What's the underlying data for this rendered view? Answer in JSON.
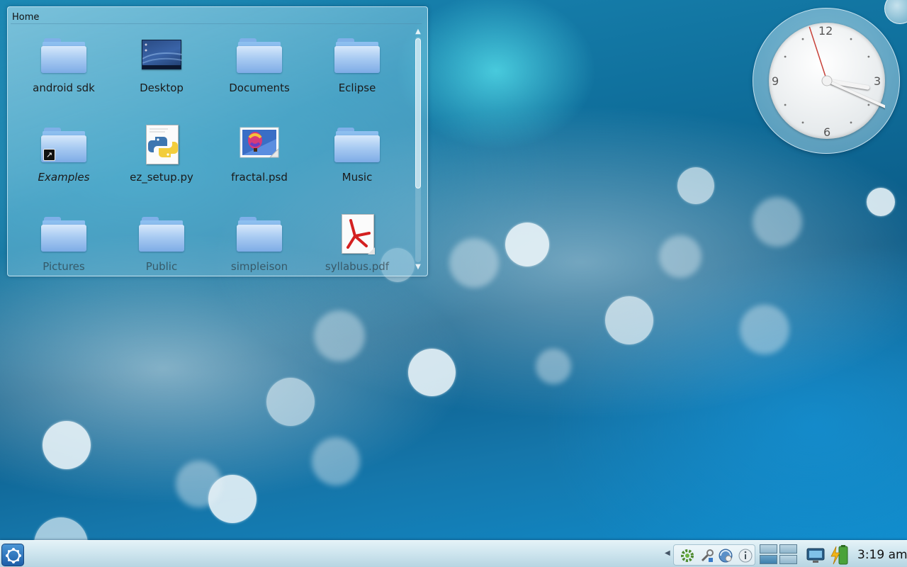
{
  "folderview": {
    "title": "Home",
    "items": [
      {
        "label": "android sdk",
        "kind": "folder"
      },
      {
        "label": "Desktop",
        "kind": "desktop"
      },
      {
        "label": "Documents",
        "kind": "folder"
      },
      {
        "label": "Eclipse",
        "kind": "folder"
      },
      {
        "label": "Examples",
        "kind": "folder-link"
      },
      {
        "label": "ez_setup.py",
        "kind": "python"
      },
      {
        "label": "fractal.psd",
        "kind": "image"
      },
      {
        "label": "Music",
        "kind": "folder"
      },
      {
        "label": "Pictures",
        "kind": "folder"
      },
      {
        "label": "Public",
        "kind": "folder"
      },
      {
        "label": "simpleison",
        "kind": "folder"
      },
      {
        "label": "syllabus.pdf",
        "kind": "pdf"
      }
    ]
  },
  "clock_widget": {
    "numerals": {
      "n12": "12",
      "n3": "3",
      "n6": "6",
      "n9": "9"
    },
    "hour": 3,
    "minute": 19,
    "second": 57
  },
  "panel": {
    "launcher_icon": "kde-kickoff-icon",
    "tray_icons": [
      "updates-icon",
      "network-tools-icon",
      "network-monitor-icon",
      "info-icon"
    ],
    "virtual_desktops": 4,
    "active_desktop": 1,
    "clock": "3:19 am"
  },
  "colors": {
    "wallpaper_base": "#0f6f9c",
    "panel": "#cfe6ef",
    "folder": "#a9cbf2",
    "pdf_red": "#d42020"
  }
}
